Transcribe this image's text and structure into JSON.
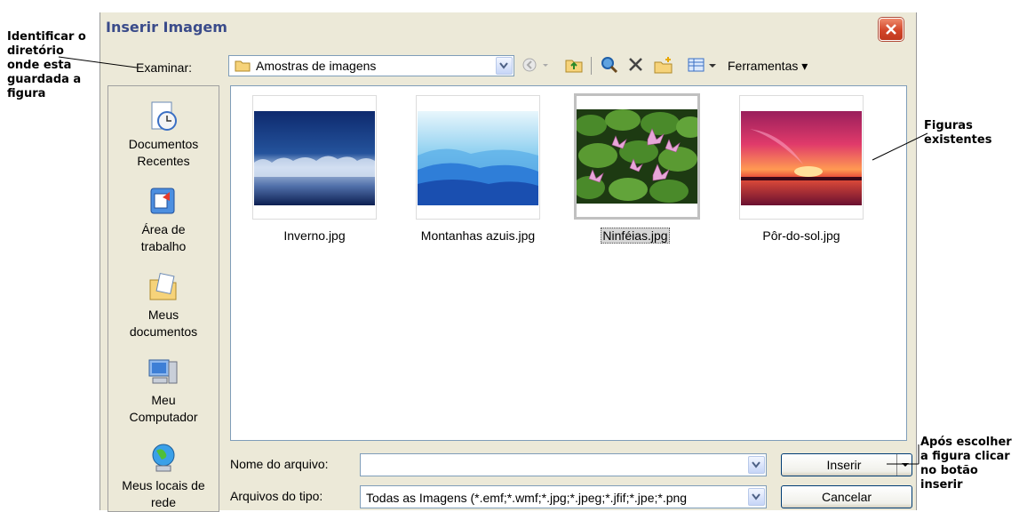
{
  "annotations": {
    "directory_note": "Identificar o\ndiretório\nonde esta\nguardada a\nfigura",
    "figures_note": "Figuras\nexistentes",
    "insert_note": "Após escolher\na figura clicar\nno botão\ninserir"
  },
  "dialog": {
    "title": "Inserir Imagem",
    "look_in_label": "Examinar:",
    "look_in_value": "Amostras de imagens",
    "tools_label": "Ferramentas ▾",
    "places": [
      {
        "label": "Documentos\nRecentes",
        "icon": "recent-documents-icon"
      },
      {
        "label": "Área de\ntrabalho",
        "icon": "desktop-icon"
      },
      {
        "label": "Meus\ndocumentos",
        "icon": "my-documents-icon"
      },
      {
        "label": "Meu\nComputador",
        "icon": "my-computer-icon"
      },
      {
        "label": "Meus locais de\nrede",
        "icon": "network-places-icon"
      }
    ],
    "files": [
      {
        "name": "Inverno.jpg",
        "selected": false
      },
      {
        "name": "Montanhas azuis.jpg",
        "selected": false
      },
      {
        "name": "Ninféias.jpg",
        "selected": true
      },
      {
        "name": "Pôr-do-sol.jpg",
        "selected": false
      }
    ],
    "file_name_label": "Nome do arquivo:",
    "file_name_value": "",
    "file_type_label": "Arquivos do tipo:",
    "file_type_value": "Todas as Imagens (*.emf;*.wmf;*.jpg;*.jpeg;*.jfif;*.jpe;*.png",
    "insert_label": "Inserir",
    "cancel_label": "Cancelar"
  }
}
